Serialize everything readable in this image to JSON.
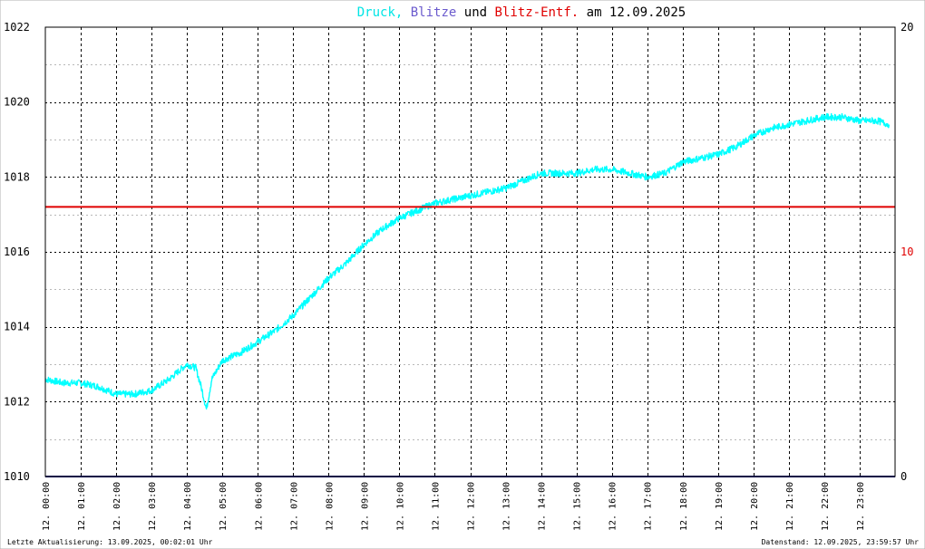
{
  "chart_data": {
    "type": "line",
    "title_parts": [
      {
        "text": "Druck,",
        "color": "#00e5e5"
      },
      {
        "text": "Blitze",
        "color": "#6a5acd"
      },
      {
        "text": "und",
        "color": "#000000"
      },
      {
        "text": "Blitz-Entf.",
        "color": "#e00000"
      },
      {
        "text": "am 12.09.2025",
        "color": "#000000"
      }
    ],
    "y_left": {
      "min": 1010,
      "max": 1022,
      "ticks": [
        1010,
        1012,
        1014,
        1016,
        1018,
        1020,
        1022
      ]
    },
    "y_right": {
      "min": 0,
      "max": 20,
      "ticks": [
        {
          "value": 0,
          "label": "0",
          "color": "#000000"
        },
        {
          "value": 10,
          "label": "10",
          "color": "#e00000"
        },
        {
          "value": 20,
          "label": "20",
          "color": "#000000"
        }
      ]
    },
    "x_range": [
      0,
      24
    ],
    "x_ticks": [
      {
        "hour": 0,
        "label": "12. 00:00"
      },
      {
        "hour": 1,
        "label": "12. 01:00"
      },
      {
        "hour": 2,
        "label": "12. 02:00"
      },
      {
        "hour": 3,
        "label": "12. 03:00"
      },
      {
        "hour": 4,
        "label": "12. 04:00"
      },
      {
        "hour": 5,
        "label": "12. 05:00"
      },
      {
        "hour": 6,
        "label": "12. 06:00"
      },
      {
        "hour": 7,
        "label": "12. 07:00"
      },
      {
        "hour": 8,
        "label": "12. 08:00"
      },
      {
        "hour": 9,
        "label": "12. 09:00"
      },
      {
        "hour": 10,
        "label": "12. 10:00"
      },
      {
        "hour": 11,
        "label": "12. 11:00"
      },
      {
        "hour": 12,
        "label": "12. 12:00"
      },
      {
        "hour": 13,
        "label": "12. 13:00"
      },
      {
        "hour": 14,
        "label": "12. 14:00"
      },
      {
        "hour": 15,
        "label": "12. 15:00"
      },
      {
        "hour": 16,
        "label": "12. 16:00"
      },
      {
        "hour": 17,
        "label": "12. 17:00"
      },
      {
        "hour": 18,
        "label": "12. 18:00"
      },
      {
        "hour": 19,
        "label": "12. 19:00"
      },
      {
        "hour": 20,
        "label": "12. 20:00"
      },
      {
        "hour": 21,
        "label": "12. 21:00"
      },
      {
        "hour": 22,
        "label": "12. 22:00"
      },
      {
        "hour": 23,
        "label": "12. 23:00"
      }
    ],
    "grid": true,
    "series": [
      {
        "name": "Druck",
        "color": "#00ffff",
        "axis": "left",
        "x": [
          0,
          0.5,
          1,
          1.5,
          2,
          2.5,
          3,
          3.5,
          4,
          4.25,
          4.4,
          4.55,
          4.7,
          5,
          5.5,
          6,
          6.5,
          7,
          7.5,
          8,
          8.5,
          9,
          9.5,
          10,
          10.5,
          11,
          11.5,
          12,
          12.5,
          13,
          13.5,
          14,
          14.5,
          15,
          15.5,
          16,
          16.5,
          17,
          17.5,
          18,
          18.5,
          19,
          19.5,
          20,
          20.5,
          21,
          21.5,
          22,
          22.5,
          23,
          23.5,
          23.83
        ],
        "values": [
          1012.6,
          1012.5,
          1012.5,
          1012.4,
          1012.2,
          1012.2,
          1012.3,
          1012.6,
          1013.0,
          1012.9,
          1012.4,
          1011.8,
          1012.6,
          1013.1,
          1013.3,
          1013.6,
          1013.9,
          1014.3,
          1014.8,
          1015.3,
          1015.7,
          1016.2,
          1016.6,
          1016.9,
          1017.1,
          1017.3,
          1017.4,
          1017.5,
          1017.6,
          1017.7,
          1017.9,
          1018.1,
          1018.1,
          1018.1,
          1018.2,
          1018.2,
          1018.1,
          1018.0,
          1018.1,
          1018.4,
          1018.5,
          1018.6,
          1018.8,
          1019.1,
          1019.3,
          1019.4,
          1019.5,
          1019.6,
          1019.6,
          1019.5,
          1019.5,
          1019.4
        ]
      },
      {
        "name": "Blitze",
        "color": "#1a1a8c",
        "axis": "right",
        "x": [
          0,
          24
        ],
        "values": [
          0,
          0
        ]
      },
      {
        "name": "Blitz-Entf.",
        "color": "#e00000",
        "axis": "right",
        "x": [
          0,
          24
        ],
        "values": [
          12,
          12
        ]
      }
    ]
  },
  "footer": {
    "left": "Letzte Aktualisierung: 13.09.2025, 00:02:01 Uhr",
    "right": "Datenstand: 12.09.2025, 23:59:57 Uhr"
  }
}
